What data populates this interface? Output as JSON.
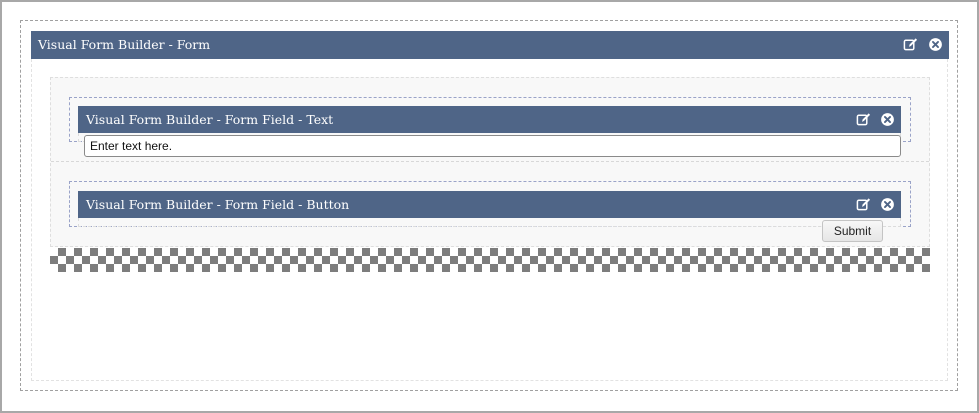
{
  "form": {
    "title": "Visual Form Builder - Form",
    "edit_icon": "edit-icon",
    "close_icon": "close-circle-icon"
  },
  "fields": [
    {
      "type": "text",
      "title": "Visual Form Builder - Form Field - Text",
      "value": "Enter text here.",
      "edit_icon": "edit-icon",
      "close_icon": "close-circle-icon"
    },
    {
      "type": "button",
      "title": "Visual Form Builder - Form Field - Button",
      "button_label": "Submit",
      "edit_icon": "edit-icon",
      "close_icon": "close-circle-icon"
    }
  ],
  "colors": {
    "header_bg": "#4f6587",
    "header_text": "#ffffff",
    "dashed_border": "#9aa3c8",
    "zone_bg": "#f8f8f8",
    "checker_dark": "#7d7d7d"
  }
}
